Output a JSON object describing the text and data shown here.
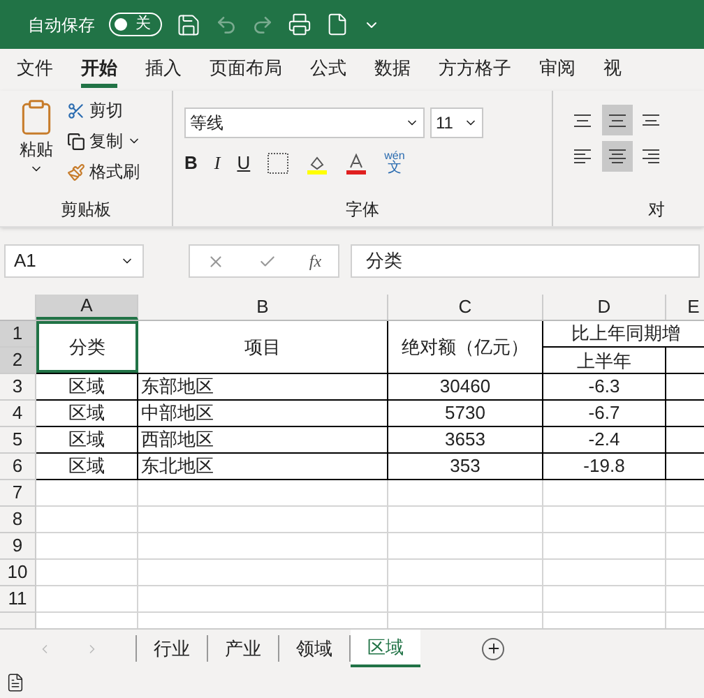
{
  "title_bar": {
    "autosave_label": "自动保存",
    "autosave_toggle": {
      "label": "关",
      "on": false
    }
  },
  "ribbon_tabs": [
    {
      "label": "文件",
      "selected": false
    },
    {
      "label": "开始",
      "selected": true
    },
    {
      "label": "插入",
      "selected": false
    },
    {
      "label": "页面布局",
      "selected": false
    },
    {
      "label": "公式",
      "selected": false
    },
    {
      "label": "数据",
      "selected": false
    },
    {
      "label": "方方格子",
      "selected": false
    },
    {
      "label": "审阅",
      "selected": false
    },
    {
      "label": "视",
      "selected": false
    }
  ],
  "clipboard": {
    "paste": "粘贴",
    "cut": "剪切",
    "copy": "复制",
    "format_painter": "格式刷",
    "group_label": "剪贴板"
  },
  "font": {
    "font_name": "等线",
    "font_size": "11",
    "bold": "B",
    "italic": "I",
    "underline": "U",
    "phonetic_top": "wén",
    "phonetic_bottom": "文",
    "group_label": "字体"
  },
  "alignment": {
    "group_label": "对",
    "buttons": [
      {
        "kind": "top",
        "selected": false
      },
      {
        "kind": "middle",
        "selected": true
      },
      {
        "kind": "bottom",
        "selected": false
      },
      {
        "kind": "left",
        "selected": false
      },
      {
        "kind": "center",
        "selected": true
      },
      {
        "kind": "right",
        "selected": false
      }
    ]
  },
  "formula_bar": {
    "name_box": "A1",
    "fx": "fx",
    "formula": "分类"
  },
  "columns": [
    {
      "label": "A",
      "selected": true
    },
    {
      "label": "B",
      "selected": false
    },
    {
      "label": "C",
      "selected": false
    },
    {
      "label": "D",
      "selected": false
    },
    {
      "label": "E",
      "selected": false
    }
  ],
  "header": {
    "category": "分类",
    "item": "项目",
    "amount": "绝对额（亿元）",
    "growth": "比上年同期增",
    "first_half": "上半年"
  },
  "rows": [
    {
      "category": "区域",
      "item": "东部地区",
      "amount": "30460",
      "first_half": "-6.3"
    },
    {
      "category": "区域",
      "item": "中部地区",
      "amount": "5730",
      "first_half": "-6.7"
    },
    {
      "category": "区域",
      "item": "西部地区",
      "amount": "3653",
      "first_half": "-2.4"
    },
    {
      "category": "区域",
      "item": "东北地区",
      "amount": "353",
      "first_half": "-19.8"
    }
  ],
  "row_numbers": [
    "1",
    "2",
    "3",
    "4",
    "5",
    "6",
    "7",
    "8",
    "9",
    "10",
    "11"
  ],
  "sheet_tabs": [
    {
      "label": "行业",
      "selected": false
    },
    {
      "label": "产业",
      "selected": false
    },
    {
      "label": "领域",
      "selected": false
    },
    {
      "label": "区域",
      "selected": true
    }
  ]
}
